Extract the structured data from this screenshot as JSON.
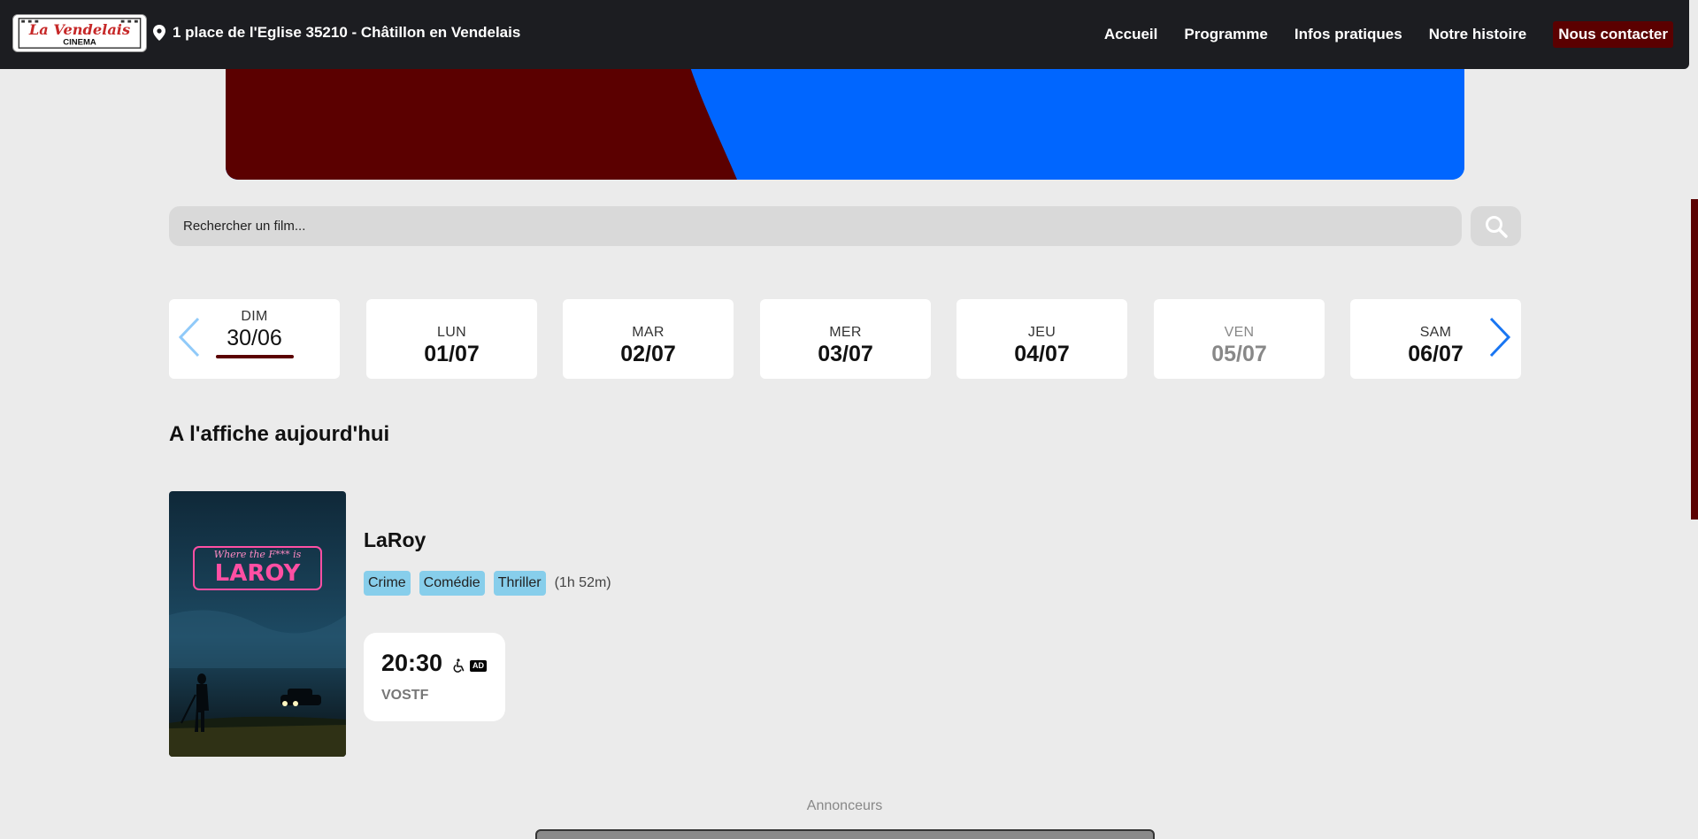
{
  "header": {
    "logo_alt": "La Vendelais Cinema",
    "logo_line1": "La Vendelais",
    "logo_line2": "CINEMA",
    "address_icon": "map-pin-icon",
    "address": "1 place de l'Eglise 35210 - Châtillon en Vendelais",
    "nav": [
      {
        "label": "Accueil"
      },
      {
        "label": "Programme"
      },
      {
        "label": "Infos pratiques"
      },
      {
        "label": "Notre histoire"
      },
      {
        "label": "Nous contacter"
      }
    ]
  },
  "search": {
    "placeholder": "Rechercher un film...",
    "button_icon": "search-icon"
  },
  "dates": [
    {
      "day": "DIM",
      "date": "30/06",
      "selected": true
    },
    {
      "day": "LUN",
      "date": "01/07"
    },
    {
      "day": "MAR",
      "date": "02/07"
    },
    {
      "day": "MER",
      "date": "03/07"
    },
    {
      "day": "JEU",
      "date": "04/07"
    },
    {
      "day": "VEN",
      "date": "05/07",
      "disabled": true
    },
    {
      "day": "SAM",
      "date": "06/07"
    }
  ],
  "section_title": "A l'affiche aujourd'hui",
  "movies": [
    {
      "title": "LaRoy",
      "poster_text_1": "Where the F*** is",
      "poster_text_2": "LAROY",
      "genres": [
        "Crime",
        "Comédie",
        "Thriller"
      ],
      "duration": "(1h 52m)",
      "showtimes": [
        {
          "time": "20:30",
          "icons": [
            "wheelchair-icon",
            "audio-description-icon"
          ],
          "ad_badge": "AD",
          "version": "VOSTF"
        }
      ]
    }
  ],
  "footer": {
    "annonceurs": "Annonceurs"
  },
  "colors": {
    "header_bg": "#1c1d21",
    "accent": "#5b0000",
    "banner_blue": "#0066ff",
    "tag_bg": "#87ceeb",
    "page_bg": "#ebebeb"
  }
}
